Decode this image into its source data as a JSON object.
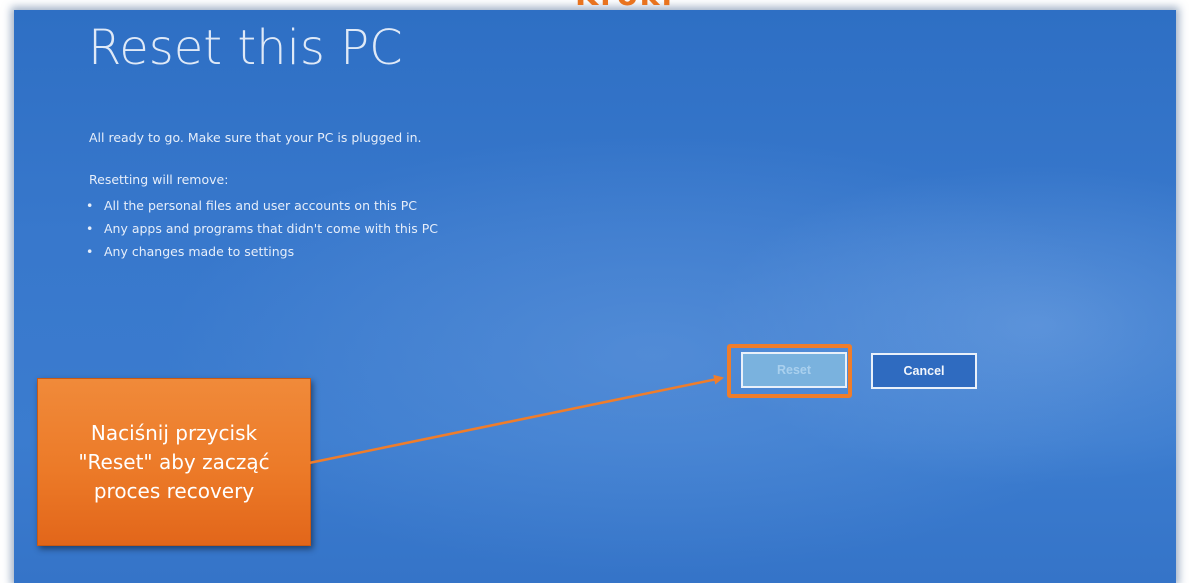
{
  "header": {
    "top_label": "Kroki"
  },
  "screen": {
    "title": "Reset this PC",
    "intro": "All ready to go. Make sure that your PC is plugged in.",
    "removes_heading": "Resetting will remove:",
    "items": [
      "All the personal files and user accounts on this PC",
      "Any apps and programs that didn't come with this PC",
      "Any changes made to settings"
    ],
    "bullet": "•",
    "buttons": {
      "reset": "Reset",
      "cancel": "Cancel"
    }
  },
  "annotation": {
    "callout_text": "Naciśnij przycisk\n\"Reset\" aby zacząć\nproces recovery",
    "accent_color": "#ef7d2b"
  },
  "colors": {
    "screen_blue": "#3878cc",
    "reset_button": "#7ab2de",
    "callout_orange": "#ec7a28"
  }
}
